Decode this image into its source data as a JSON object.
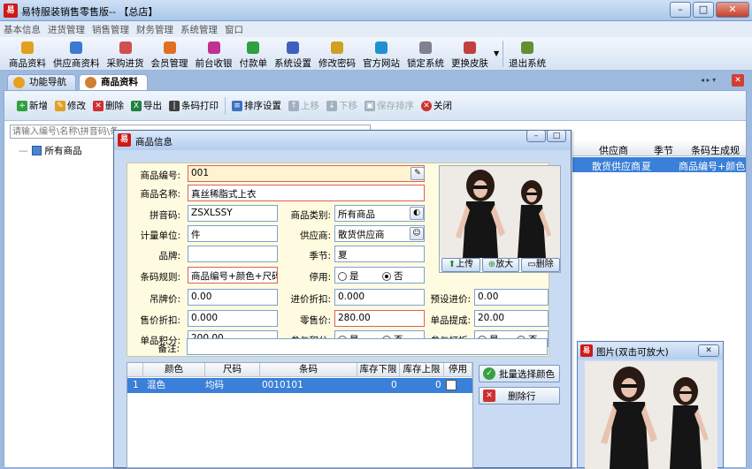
{
  "app": {
    "title": "易特服装销售零售版-- 【总店】",
    "logo": "易"
  },
  "menu": [
    "基本信息",
    "进货管理",
    "销售管理",
    "财务管理",
    "系统管理",
    "窗口"
  ],
  "toolbar": [
    {
      "label": "商品资料",
      "icon": "goods-icon",
      "color": "#e0a020"
    },
    {
      "label": "供应商资料",
      "icon": "supplier-icon",
      "color": "#3a7ad0"
    },
    {
      "label": "采购进货",
      "icon": "purchase-icon",
      "color": "#d05050"
    },
    {
      "label": "会员管理",
      "icon": "member-icon",
      "color": "#e07020"
    },
    {
      "label": "前台收银",
      "icon": "cashier-icon",
      "color": "#c03090"
    },
    {
      "label": "付款单",
      "icon": "payment-icon",
      "color": "#30a040"
    },
    {
      "label": "系统设置",
      "icon": "settings-icon",
      "color": "#4060c0"
    },
    {
      "label": "修改密码",
      "icon": "key-icon",
      "color": "#d0a020"
    },
    {
      "label": "官方网站",
      "icon": "web-icon",
      "color": "#2090d0"
    },
    {
      "label": "锁定系统",
      "icon": "lock-icon",
      "color": "#808090"
    },
    {
      "label": "更换皮肤",
      "icon": "skin-icon",
      "color": "#c04040"
    },
    {
      "label": "退出系统",
      "icon": "exit-icon",
      "color": "#609030"
    }
  ],
  "tabs": [
    {
      "label": "功能导航",
      "active": false
    },
    {
      "label": "商品资料",
      "active": true
    }
  ],
  "subtoolbar": [
    {
      "label": "新增",
      "icon": "add-icon",
      "color": "#30a040",
      "disabled": false
    },
    {
      "label": "修改",
      "icon": "edit-icon",
      "color": "#e0a020",
      "disabled": false
    },
    {
      "label": "删除",
      "icon": "delete-icon",
      "color": "#d03030",
      "disabled": false
    },
    {
      "label": "导出",
      "icon": "excel-icon",
      "color": "#208040",
      "disabled": false
    },
    {
      "label": "条码打印",
      "icon": "barcode-icon",
      "color": "#404040",
      "disabled": false
    },
    {
      "label": "排序设置",
      "icon": "sort-icon",
      "color": "#4070c0",
      "disabled": false
    },
    {
      "label": "上移",
      "icon": "up-icon",
      "color": "#a0b0c0",
      "disabled": true
    },
    {
      "label": "下移",
      "icon": "down-icon",
      "color": "#a0b0c0",
      "disabled": true
    },
    {
      "label": "保存排序",
      "icon": "save-icon",
      "color": "#a0b0c0",
      "disabled": true
    },
    {
      "label": "关闭",
      "icon": "close-icon",
      "color": "#d03030",
      "disabled": false
    }
  ],
  "search": {
    "placeholder": "请输入编号\\名称\\拼音码\\条"
  },
  "tree": {
    "root": "所有商品"
  },
  "grid": {
    "headers": [
      "供应商",
      "季节",
      "条码生成规"
    ],
    "row": [
      "散货供应商",
      "夏",
      "商品编号+颜色"
    ]
  },
  "dialog": {
    "title": "商品信息",
    "fields": {
      "code_label": "商品编号:",
      "code": "001",
      "name_label": "商品名称:",
      "name": "真丝稀脂式上衣",
      "pinyin_label": "拼音码:",
      "pinyin": "ZSXLSSY",
      "category_label": "商品类别:",
      "category": "所有商品",
      "unit_label": "计量单位:",
      "unit": "件",
      "supplier_label": "供应商:",
      "supplier": "散货供应商",
      "brand_label": "品牌:",
      "brand": "",
      "season_label": "季节:",
      "season": "夏",
      "barcode_rule_label": "条码规则:",
      "barcode_rule": "商品编号+颜色+尺码",
      "disabled_label": "停用:",
      "yes": "是",
      "no": "否",
      "tag_price_label": "吊牌价:",
      "tag_price": "0.00",
      "purchase_discount_label": "进价折扣:",
      "purchase_discount": "0.000",
      "preset_price_label": "预设进价:",
      "preset_price": "0.00",
      "sale_discount_label": "售价折扣:",
      "sale_discount": "0.000",
      "retail_price_label": "零售价:",
      "retail_price": "280.00",
      "commission_label": "单品提成:",
      "commission": "20.00",
      "points_label": "单品积分:",
      "points": "200.00",
      "join_points_label": "参与积分:",
      "join_discount_label": "参与打折:",
      "remark_label": "备注:",
      "remark": ""
    },
    "photo_buttons": {
      "upload": "上传",
      "zoom": "放大",
      "delete": "删除"
    },
    "table": {
      "headers": [
        "颜色",
        "尺码",
        "条码",
        "库存下限",
        "库存上限",
        "停用"
      ],
      "rows": [
        {
          "no": "1",
          "color": "混色",
          "size": "均码",
          "barcode": "0010101",
          "min": "0",
          "max": "0"
        }
      ]
    },
    "actions": {
      "batch_color": "批量选择颜色",
      "delete_row": "删除行"
    }
  },
  "popup": {
    "title": "图片(双击可放大)"
  }
}
